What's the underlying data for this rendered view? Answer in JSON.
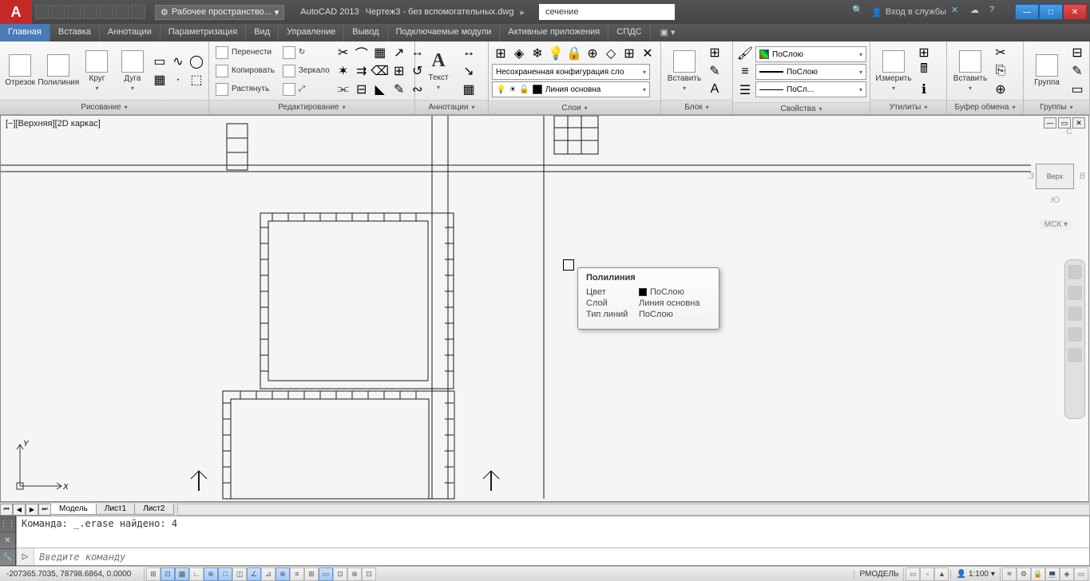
{
  "title": {
    "app": "AutoCAD 2013",
    "doc": "Чертеж3 - без вспомогательных.dwg",
    "workspace": "Рабочее пространство...",
    "search": "сечение",
    "signin": "Вход в службы"
  },
  "tabs": {
    "items": [
      "Главная",
      "Вставка",
      "Аннотации",
      "Параметризация",
      "Вид",
      "Управление",
      "Вывод",
      "Подключаемые модули",
      "Активные приложения",
      "СПДС"
    ],
    "active": 0
  },
  "ribbon": {
    "draw": {
      "title": "Рисование",
      "line": "Отрезок",
      "polyline": "Полилиния",
      "circle": "Круг",
      "arc": "Дуга"
    },
    "modify": {
      "title": "Редактирование",
      "move": "Перенести",
      "copy": "Копировать",
      "stretch": "Растянуть",
      "rotate": "Повернуть",
      "mirror": "Зеркало",
      "scale": "Масштаб"
    },
    "annot": {
      "title": "Аннотации",
      "text": "Текст"
    },
    "layers": {
      "title": "Слои",
      "unsaved": "Несохраненная конфигурация сло",
      "current": "Линия основна"
    },
    "block": {
      "title": "Блок",
      "insert": "Вставить"
    },
    "props": {
      "title": "Свойства",
      "color": "ПоСлою",
      "lweight": "ПоСлою",
      "ltype": "ПоСл..."
    },
    "utils": {
      "title": "Утилиты",
      "measure": "Измерить"
    },
    "clip": {
      "title": "Буфер обмена",
      "paste": "Вставить"
    },
    "groups": {
      "title": "Группы",
      "group": "Группа"
    }
  },
  "viewport": {
    "label": "[−][Верхняя][2D каркас]"
  },
  "viewcube": {
    "face": "Верх",
    "wcs": "МСК",
    "c": "С",
    "b1": "З",
    "b2": "В",
    "b3": "Ю"
  },
  "tooltip": {
    "title": "Полилиния",
    "color_k": "Цвет",
    "color_v": "ПоСлою",
    "layer_k": "Слой",
    "layer_v": "Линия основна",
    "ltype_k": "Тип линий",
    "ltype_v": "ПоСлою"
  },
  "sheets": {
    "model": "Модель",
    "s1": "Лист1",
    "s2": "Лист2"
  },
  "cmd": {
    "history": "Команда: _.erase найдено: 4",
    "placeholder": "Введите команду"
  },
  "status": {
    "coords": "-207365.7035, 78798.6864, 0.0000",
    "model": "РМОДЕЛЬ",
    "scale": "1:100"
  }
}
